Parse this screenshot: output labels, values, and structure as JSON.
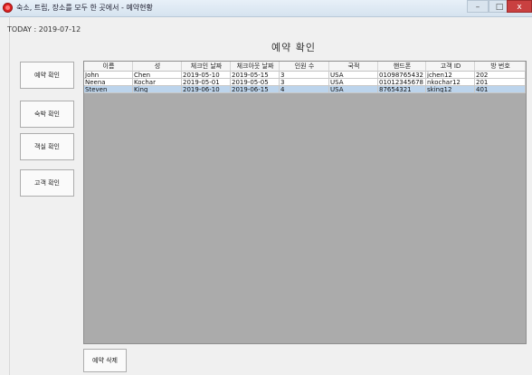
{
  "window": {
    "title": "숙소, 트립, 장소를 모두 한 곳에서 - 예약현황",
    "minimize_glyph": "–",
    "maximize_glyph": "□",
    "close_glyph": "x"
  },
  "today_label": "TODAY : 2019-07-12",
  "page_title": "예약 확인",
  "sidebar": {
    "items": [
      {
        "label": "예약 확인"
      },
      {
        "label": "숙박 확인"
      },
      {
        "label": "객실 확인"
      },
      {
        "label": "고객 확인"
      }
    ]
  },
  "table": {
    "columns": [
      "이름",
      "성",
      "체크인 날짜",
      "체크아웃 날짜",
      "인원 수",
      "국적",
      "핸드폰",
      "고객 ID",
      "방 번호"
    ],
    "rows": [
      [
        "John",
        "Chen",
        "2019-05-10",
        "2019-05-15",
        "3",
        "USA",
        "01098765432",
        "jchen12",
        "202"
      ],
      [
        "Neena",
        "Kochar",
        "2019-05-01",
        "2019-05-05",
        "3",
        "USA",
        "01012345678",
        "nkochar12",
        "201"
      ],
      [
        "Steven",
        "King",
        "2019-06-10",
        "2019-06-15",
        "4",
        "USA",
        "87654321",
        "sking12",
        "401"
      ]
    ],
    "selected_row": 2
  },
  "delete_button_label": "예약 삭제",
  "colors": {
    "grid_background": "#ababab",
    "selected_row": "#bcd4ec",
    "close_button": "#c94040"
  }
}
